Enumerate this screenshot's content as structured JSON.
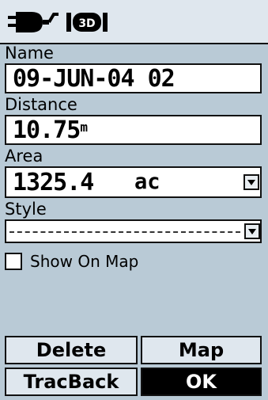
{
  "status_bar": {
    "icons": [
      "battery-icon",
      "gps-3d-icon"
    ]
  },
  "fields": {
    "name": {
      "label": "Name",
      "value": "09-JUN-04 02"
    },
    "distance": {
      "label": "Distance",
      "value": "10.75",
      "unit": "m"
    },
    "area": {
      "label": "Area",
      "value": "1325.4",
      "unit": "ac"
    },
    "style": {
      "label": "Style",
      "value_style": "dashed"
    }
  },
  "show_on_map": {
    "label": "Show On Map",
    "checked": false
  },
  "buttons": {
    "delete": "Delete",
    "map": "Map",
    "tracback": "TracBack",
    "ok": "OK"
  }
}
